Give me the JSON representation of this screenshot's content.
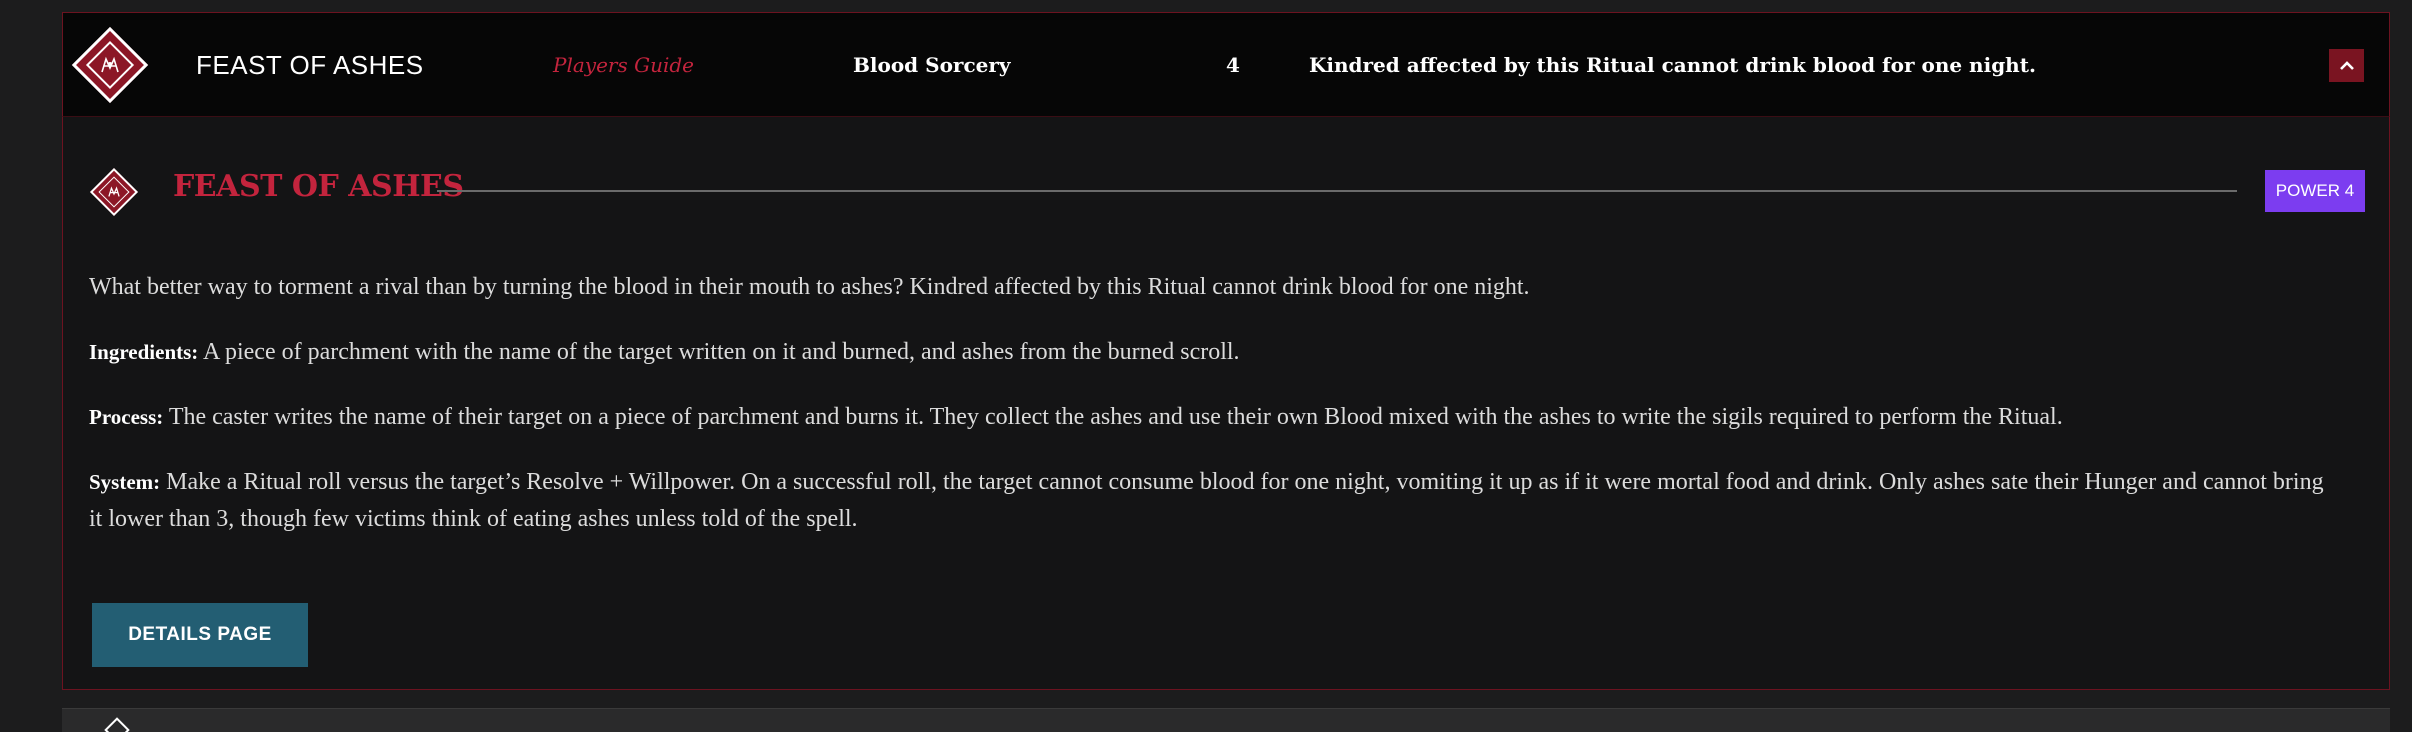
{
  "summary": {
    "title": "FEAST OF ASHES",
    "source": "Players Guide",
    "discipline": "Blood Sorcery",
    "level": "4",
    "description": "Kindred affected by this Ritual cannot drink blood for one night.",
    "emblem_icon": "blood-sorcery-sigil-icon",
    "toggle_icon": "chevron-up-icon"
  },
  "detail": {
    "title": "FEAST OF ASHES",
    "power_badge": "POWER 4",
    "intro": "What better way to torment a rival than by turning the blood in their mouth to ashes? Kindred affected by this Ritual cannot drink blood for one night.",
    "ingredients_label": "Ingredients:",
    "ingredients_text": " A piece of parchment with the name of the target written on it and burned, and ashes from the burned scroll.",
    "process_label": "Process:",
    "process_text": " The caster writes the name of their target on a piece of parchment and burns it. They collect the ashes and use their own Blood mixed with the ashes to write the sigils required to perform the Ritual.",
    "system_label": "System:",
    "system_text": " Make a Ritual roll versus the target’s Resolve + Willpower. On a successful roll, the target cannot consume blood for one night, vomiting it up as if it were mortal food and drink. Only ashes sate their Hunger and cannot bring it lower than 3, though few victims think of eating ashes unless told of the spell.",
    "details_button": "DETAILS PAGE"
  },
  "colors": {
    "accent_red": "#c3243d",
    "emblem_red": "#8c1726",
    "power_purple": "#7c3df0",
    "button_teal": "#235e73"
  }
}
